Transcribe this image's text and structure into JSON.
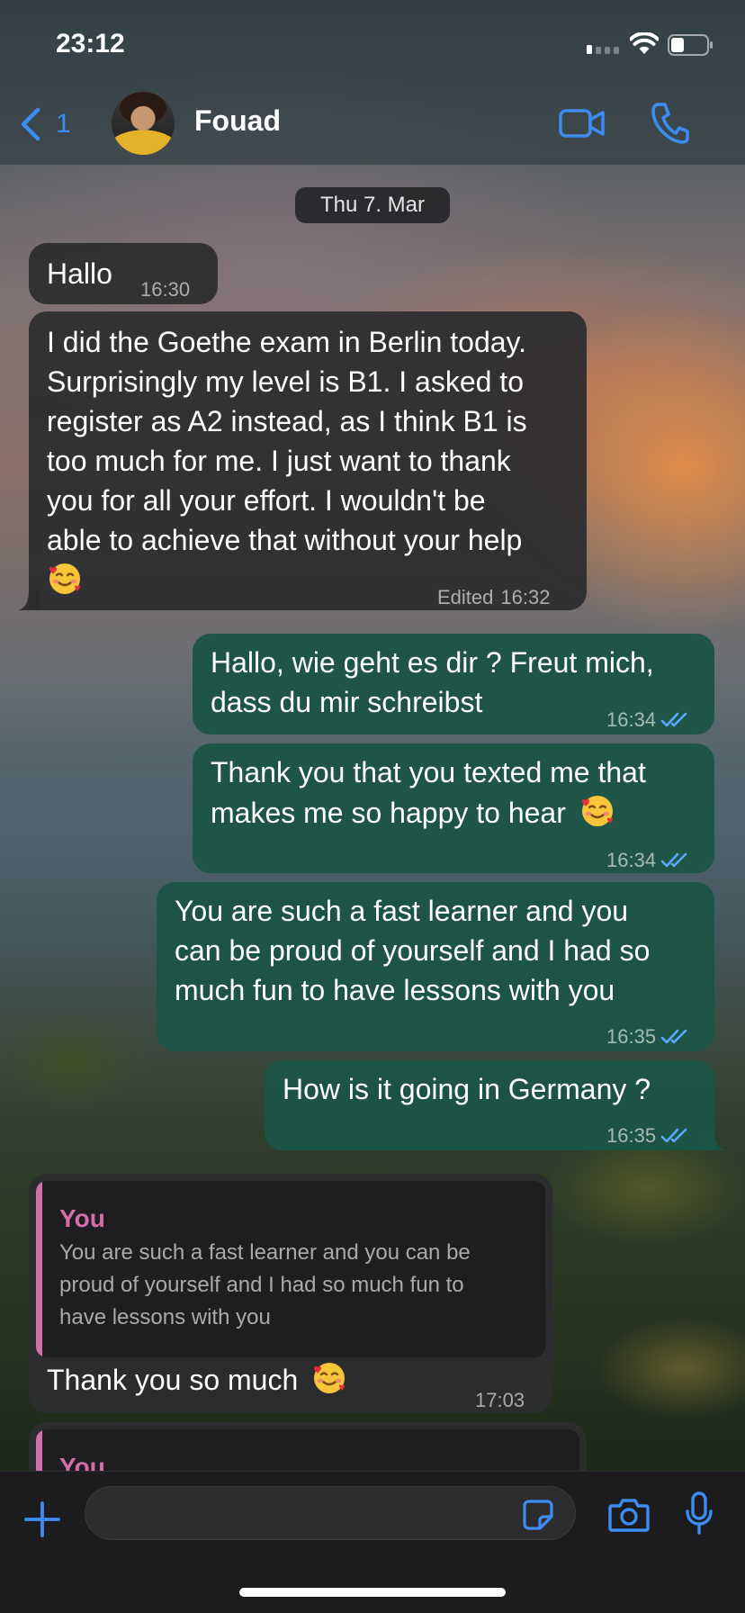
{
  "status_bar": {
    "time": "23:12"
  },
  "header": {
    "back_count": "1",
    "contact_name": "Fouad"
  },
  "date_chip": "Thu 7. Mar",
  "messages": [
    {
      "direction": "incoming",
      "lines": [
        "Hallo"
      ],
      "time": "16:30"
    },
    {
      "direction": "incoming",
      "lines": [
        "I did the Goethe exam in Berlin today.",
        "Surprisingly my level is B1. I asked to",
        "register as A2 instead, as I think B1 is",
        "too much for me. I just want to thank",
        "you for all your effort. I wouldn't be",
        "able to achieve that without your help"
      ],
      "emoji": "smiling-face-with-hearts",
      "edited_label": "Edited",
      "time": "16:32"
    },
    {
      "direction": "outgoing",
      "lines": [
        "Hallo, wie geht es dir ? Freut mich,",
        "dass du mir schreibst"
      ],
      "time": "16:34",
      "read": true
    },
    {
      "direction": "outgoing",
      "lines": [
        "Thank you that you texted me that",
        "makes me so happy to hear"
      ],
      "emoji": "smiling-face-with-hearts",
      "time": "16:34",
      "read": true
    },
    {
      "direction": "outgoing",
      "lines": [
        "You are such a fast learner and you",
        "can be proud of yourself and I had so",
        "much fun to have lessons with you"
      ],
      "time": "16:35",
      "read": true
    },
    {
      "direction": "outgoing",
      "lines": [
        "How is it going in Germany ?"
      ],
      "time": "16:35",
      "read": true
    },
    {
      "direction": "incoming",
      "quote": {
        "author": "You",
        "lines": [
          "You are such a fast learner and you can be",
          "proud of yourself and I had so much fun to",
          "have lessons with you"
        ]
      },
      "lines": [
        "Thank you so much"
      ],
      "emoji": "smiling-face-with-hearts",
      "time": "17:03"
    },
    {
      "direction": "incoming",
      "quote": {
        "author": "You"
      },
      "partial": true
    }
  ],
  "composer": {
    "input_value": "",
    "placeholder": ""
  },
  "colors": {
    "accent": "#3b8df4",
    "outgoing_bubble": "#1c5446",
    "incoming_bubble": "#2c2c2e",
    "quote_author": "#d46ea8",
    "read_ticks": "#5aa9ff"
  }
}
